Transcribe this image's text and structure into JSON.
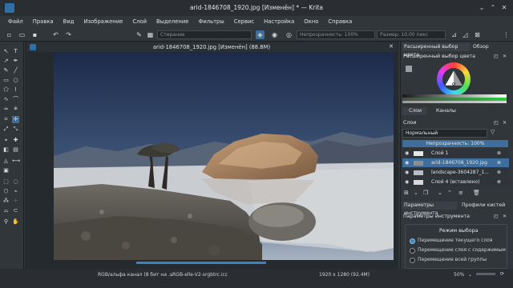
{
  "window": {
    "title": "arid-1846708_1920.jpg [Изменён] * — Krita",
    "minimize": "⌄",
    "maximize": "⌃",
    "close": "✕"
  },
  "menu": [
    "Файл",
    "Правка",
    "Вид",
    "Изображение",
    "Слой",
    "Выделение",
    "Фильтры",
    "Сервис",
    "Настройка",
    "Окно",
    "Справка"
  ],
  "toolbar": {
    "blend_mode": "Стирание",
    "opacity_label": "Непрозрачность: 100%",
    "size_label": "Размер: 10,00 пикс"
  },
  "document": {
    "tab_title": "arid-1846708_1920.jpg [Изменён] (88.8M)"
  },
  "docker": {
    "top_tabs": [
      "Расширенный выбор цвета",
      "Обзор"
    ],
    "color_panel_title": "Расширенный выбор цвета",
    "mid_tabs": [
      "Слои",
      "Каналы"
    ],
    "layers_title": "Слои",
    "blend_mode": "Нормальный",
    "opacity": "Непрозрачность: 100%",
    "layers": [
      {
        "name": "Слой 1",
        "selected": false
      },
      {
        "name": "arid-1846708_1920.jpg",
        "selected": true
      },
      {
        "name": "landscape-3604287_1...",
        "selected": false
      },
      {
        "name": "Слой 4 (вставлено)",
        "selected": false
      }
    ],
    "bottom_tabs": [
      "Параметры инструмента",
      "Профили кистей"
    ],
    "tool_options_title": "Параметры инструмента",
    "selection_mode_title": "Режим выбора",
    "selection_modes": [
      {
        "label": "Перемещение текущего слоя",
        "checked": true
      },
      {
        "label": "Перемещение слоя с содержимым",
        "checked": false
      },
      {
        "label": "Перемещение всей группы",
        "checked": false
      }
    ]
  },
  "status": {
    "color_model": "RGB/альфа канал (8 бит на ...",
    "profile": "sRGB-elle-V2-srgbtrc.icc",
    "dimensions": "1920 x 1280 (92.4M)",
    "zoom": "50%"
  },
  "colors": {
    "accent": "#3a83c4",
    "selection": "#3e6f9c",
    "window_bg": "#31363b"
  }
}
